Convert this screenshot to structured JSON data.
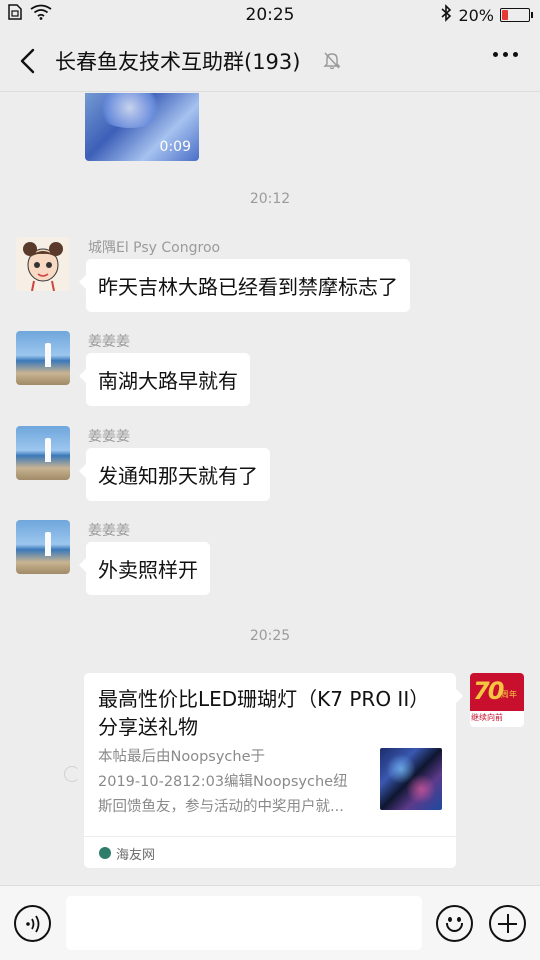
{
  "status_bar": {
    "time": "20:25",
    "battery_text": "20%",
    "battery_level": 0.2,
    "battery_color": "#e53935",
    "left_icons": [
      "sim-card-icon",
      "wifi-icon"
    ],
    "right_icons": [
      "bluetooth-icon",
      "battery-icon"
    ]
  },
  "header": {
    "title": "长春鱼友技术互助群(193)",
    "back_icon": "chevron-left-icon",
    "mute_icon": "bell-off-icon",
    "more_icon": "more-dots-icon"
  },
  "chat": {
    "video": {
      "duration": "0:09"
    },
    "timestamps": [
      "20:12",
      "20:25"
    ],
    "messages": [
      {
        "sender": "城隅El Psy Congroo",
        "text": "昨天吉林大路已经看到禁摩标志了",
        "avatar": "anime-avatar"
      },
      {
        "sender": "姜姜姜",
        "text": "南湖大路早就有",
        "avatar": "lighthouse-avatar"
      },
      {
        "sender": "姜姜姜",
        "text": "发通知那天就有了",
        "avatar": "lighthouse-avatar"
      },
      {
        "sender": "姜姜姜",
        "text": "外卖照样开",
        "avatar": "lighthouse-avatar"
      }
    ],
    "link_card": {
      "title": "最高性价比LED珊瑚灯（K7 PRO II）分享送礼物",
      "desc_lines": [
        "本帖最后由Noopsyche于",
        "2019-10-2812:03编辑Noopsyche纽",
        "斯回馈鱼友，参与活动的中奖用户就..."
      ],
      "source": "海友网"
    },
    "self_avatar": {
      "number": "70",
      "badge_text": "周年",
      "caption": "继续向前"
    }
  },
  "input_bar": {
    "placeholder": "",
    "voice_icon": "voice-icon",
    "emoji_icon": "emoji-icon",
    "plus_icon": "plus-icon"
  }
}
